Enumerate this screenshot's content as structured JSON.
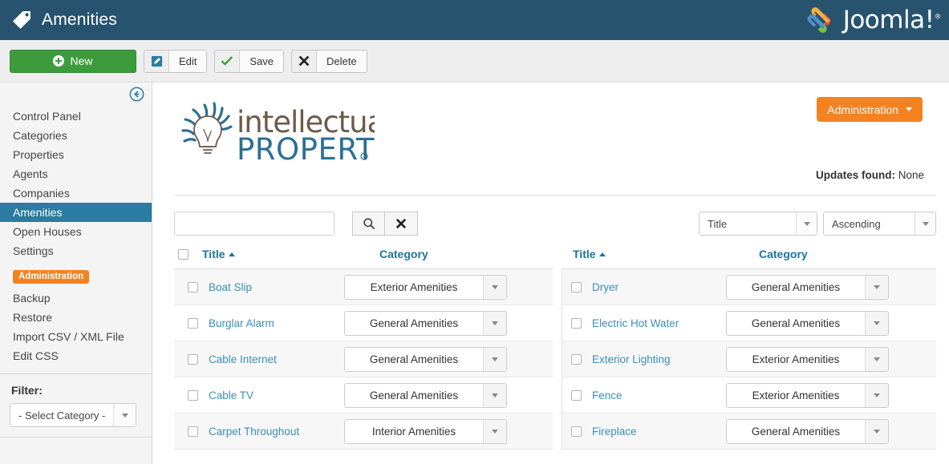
{
  "header": {
    "title": "Amenities",
    "tag_icon": "tag-icon",
    "brand_name": "Joomla!",
    "brand_registered": "®",
    "bg_color": "#27536f"
  },
  "toolbar": {
    "new_label": "New",
    "new_color": "#3c9c3c",
    "buttons": [
      {
        "label": "Edit",
        "icon": "pencil-square-icon"
      },
      {
        "label": "Save",
        "icon": "check-icon"
      },
      {
        "label": "Delete",
        "icon": "x-icon"
      }
    ]
  },
  "sidebar": {
    "collapse_icon": "circle-arrow-left-icon",
    "items": [
      {
        "label": "Control Panel",
        "active": false
      },
      {
        "label": "Categories",
        "active": false
      },
      {
        "label": "Properties",
        "active": false
      },
      {
        "label": "Agents",
        "active": false
      },
      {
        "label": "Companies",
        "active": false
      },
      {
        "label": "Amenities",
        "active": true
      },
      {
        "label": "Open Houses",
        "active": false
      },
      {
        "label": "Settings",
        "active": false
      }
    ],
    "admin_badge": "Administration",
    "admin_badge_color": "#f58220",
    "admin_items": [
      {
        "label": "Backup"
      },
      {
        "label": "Restore"
      },
      {
        "label": "Import CSV / XML File"
      },
      {
        "label": "Edit CSS"
      }
    ],
    "filter_label": "Filter:",
    "filter_value": "- Select Category -",
    "active_color": "#2b7ca0"
  },
  "main": {
    "logo": {
      "word_top": "intellectual",
      "word_bottom": "PROPERTY",
      "registered": "®",
      "icon": "lightbulb-icon"
    },
    "admin_button": {
      "label": "Administration",
      "icon": "chevron-down-icon",
      "color": "#f58220"
    },
    "updates": {
      "label": "Updates found:",
      "value": "None"
    },
    "search": {
      "value": "",
      "placeholder": ""
    },
    "search_button_icon": "search-icon",
    "clear_button_icon": "x-icon",
    "sort_field": "Title",
    "sort_direction": "Ascending",
    "columns": {
      "title": "Title",
      "category": "Category",
      "sort_indicator": "caret-up-icon"
    },
    "rows_left": [
      {
        "title": "Boat Slip",
        "category": "Exterior Amenities"
      },
      {
        "title": "Burglar Alarm",
        "category": "General Amenities"
      },
      {
        "title": "Cable Internet",
        "category": "General Amenities"
      },
      {
        "title": "Cable TV",
        "category": "General Amenities"
      },
      {
        "title": "Carpet Throughout",
        "category": "Interior Amenities"
      }
    ],
    "rows_right": [
      {
        "title": "Dryer",
        "category": "General Amenities"
      },
      {
        "title": "Electric Hot Water",
        "category": "General Amenities"
      },
      {
        "title": "Exterior Lighting",
        "category": "Exterior Amenities"
      },
      {
        "title": "Fence",
        "category": "Exterior Amenities"
      },
      {
        "title": "Fireplace",
        "category": "General Amenities"
      }
    ],
    "link_color": "#3b8fb5",
    "header_color": "#1a7699"
  }
}
